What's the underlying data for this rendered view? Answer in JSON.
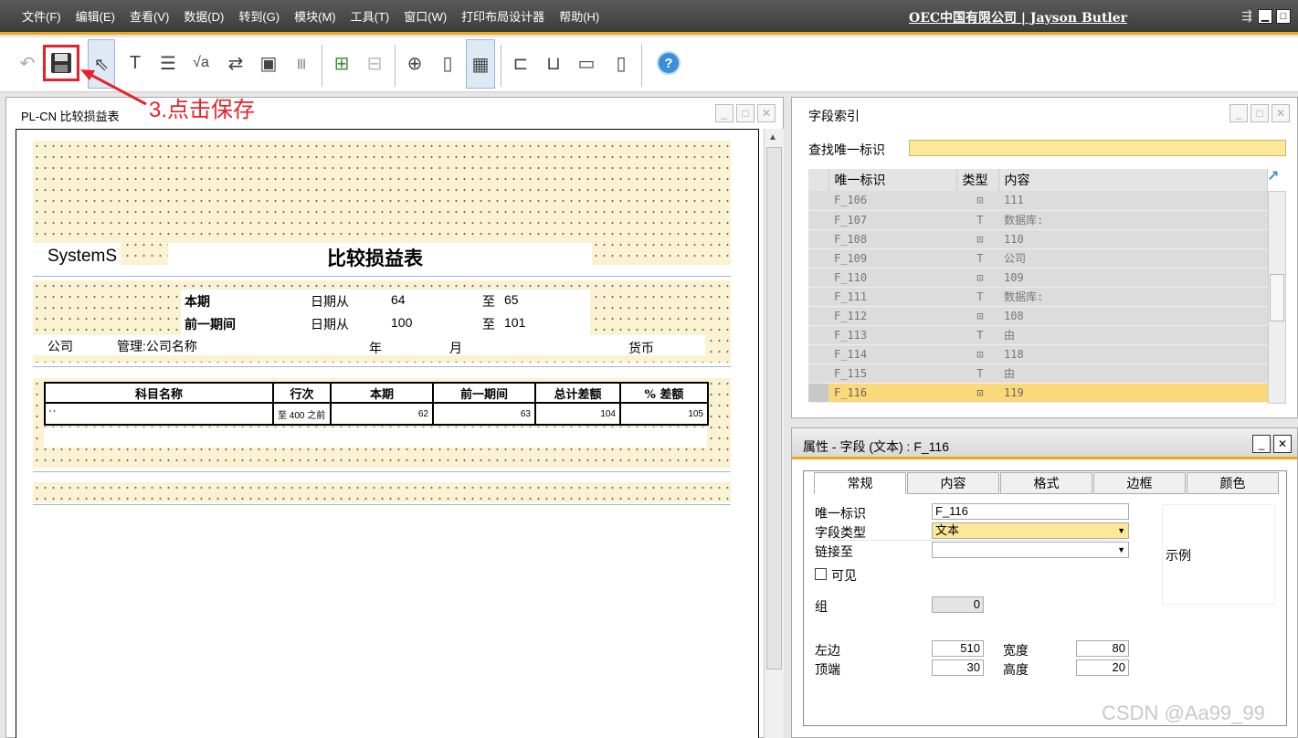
{
  "menu": [
    "文件(F)",
    "编辑(E)",
    "查看(V)",
    "数据(D)",
    "转到(G)",
    "模块(M)",
    "工具(T)",
    "窗口(W)",
    "打印布局设计器",
    "帮助(H)"
  ],
  "company": "OEC中国有限公司 | Jayson Butler",
  "annotation": "3.点击保存",
  "report": {
    "title": "PL-CN 比较损益表",
    "system_label": "SystemS",
    "heading": "比较损益表",
    "current_label": "本期",
    "prev_label": "前一期间",
    "date_from": "日期从",
    "cur_from": "64",
    "cur_to_label": "至",
    "cur_to": "65",
    "prev_from": "100",
    "prev_to": "101",
    "company_label": "公司",
    "company_name": "管理:公司名称",
    "year": "年",
    "month": "月",
    "currency": "货币",
    "columns": [
      "科目名称",
      "行次",
      "本期",
      "前一期间",
      "总计差额",
      "% 差额"
    ],
    "row": [
      "' '",
      "至 400 之前",
      "62",
      "63",
      "104",
      "105"
    ]
  },
  "index": {
    "title": "字段索引",
    "search_label": "查找唯一标识",
    "columns": [
      "唯一标识",
      "类型",
      "内容"
    ],
    "rows": [
      {
        "id": "F_106",
        "type": "⊡",
        "content": "111"
      },
      {
        "id": "F_107",
        "type": "T",
        "content": "数据库:"
      },
      {
        "id": "F_108",
        "type": "⊡",
        "content": "110"
      },
      {
        "id": "F_109",
        "type": "T",
        "content": "公司"
      },
      {
        "id": "F_110",
        "type": "⊡",
        "content": "109"
      },
      {
        "id": "F_111",
        "type": "T",
        "content": "数据库:"
      },
      {
        "id": "F_112",
        "type": "⊡",
        "content": "108"
      },
      {
        "id": "F_113",
        "type": "T",
        "content": "由"
      },
      {
        "id": "F_114",
        "type": "⊡",
        "content": "118"
      },
      {
        "id": "F_115",
        "type": "T",
        "content": "由"
      },
      {
        "id": "F_116",
        "type": "⊡",
        "content": "119"
      }
    ]
  },
  "props": {
    "title": "属性 - 字段 (文本) : F_116",
    "tabs": [
      "常规",
      "内容",
      "格式",
      "边框",
      "颜色"
    ],
    "uid_label": "唯一标识",
    "uid_value": "F_116",
    "type_label": "字段类型",
    "type_value": "文本",
    "link_label": "链接至",
    "link_value": "",
    "visible_label": "可见",
    "group_label": "组",
    "group_value": "0",
    "left_label": "左边",
    "left_value": "510",
    "width_label": "宽度",
    "width_value": "80",
    "top_label": "顶端",
    "top_value": "30",
    "height_label": "高度",
    "height_value": "20",
    "preview_label": "示例"
  },
  "watermark": "CSDN @Aa99_99"
}
